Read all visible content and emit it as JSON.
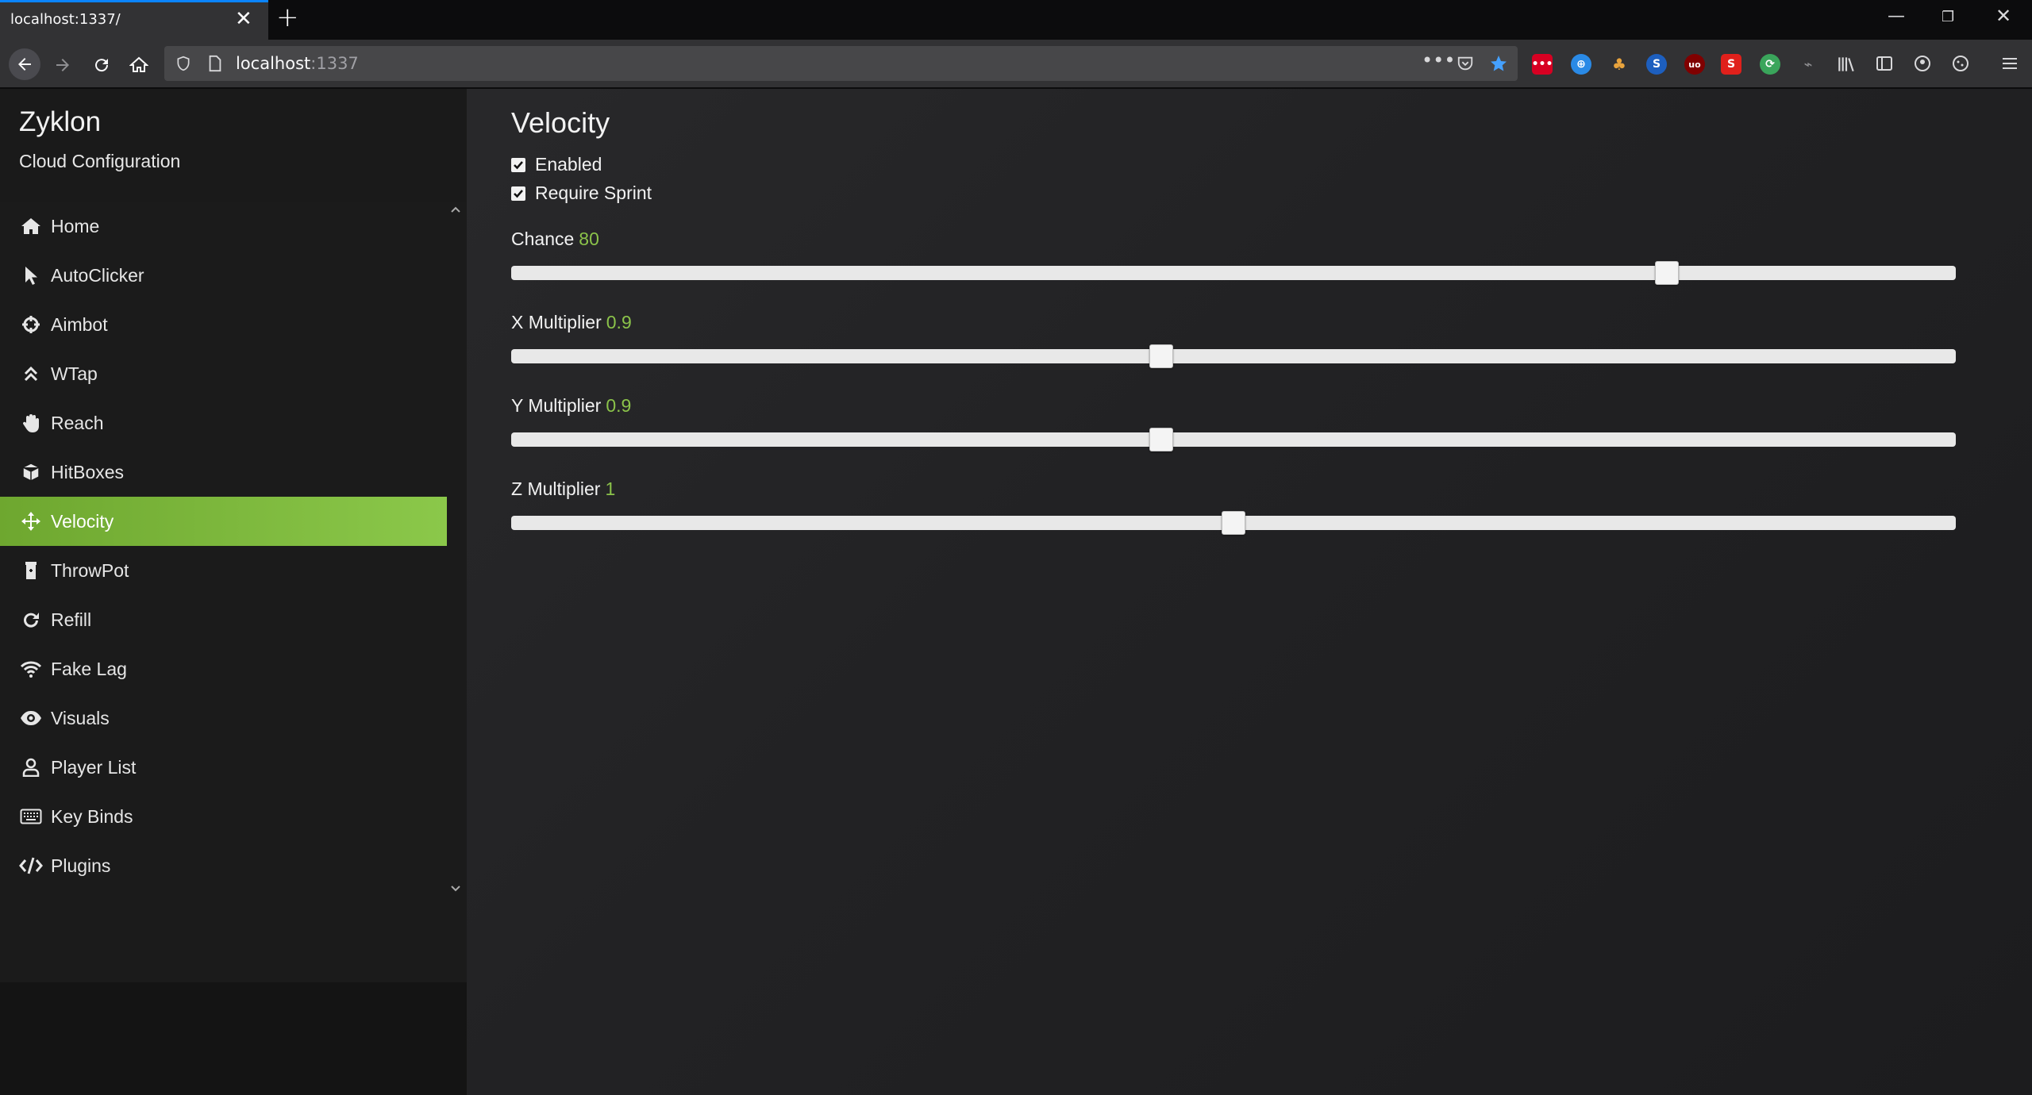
{
  "browser": {
    "tab_title": "localhost:1337/",
    "url_host": "localhost",
    "url_port": ":1337"
  },
  "sidebar": {
    "title": "Zyklon",
    "subtitle": "Cloud Configuration",
    "active_item": "Velocity",
    "accent_color": "#8bc34a",
    "items": [
      {
        "label": "Home",
        "icon": "home-icon"
      },
      {
        "label": "AutoClicker",
        "icon": "pointer-icon"
      },
      {
        "label": "Aimbot",
        "icon": "crosshair-icon"
      },
      {
        "label": "WTap",
        "icon": "double-chevron-up-icon"
      },
      {
        "label": "Reach",
        "icon": "hand-icon"
      },
      {
        "label": "HitBoxes",
        "icon": "cube-icon"
      },
      {
        "label": "Velocity",
        "icon": "arrows-move-icon"
      },
      {
        "label": "ThrowPot",
        "icon": "bottle-icon"
      },
      {
        "label": "Refill",
        "icon": "redo-icon"
      },
      {
        "label": "Fake Lag",
        "icon": "wifi-icon"
      },
      {
        "label": "Visuals",
        "icon": "eye-icon"
      },
      {
        "label": "Player List",
        "icon": "user-icon"
      },
      {
        "label": "Key Binds",
        "icon": "keyboard-icon"
      },
      {
        "label": "Plugins",
        "icon": "code-icon"
      }
    ]
  },
  "main": {
    "title": "Velocity",
    "checkboxes": [
      {
        "label": "Enabled",
        "checked": true
      },
      {
        "label": "Require Sprint",
        "checked": true
      }
    ],
    "sliders": [
      {
        "label": "Chance",
        "value": "80",
        "fraction": 0.8
      },
      {
        "label": "X Multiplier",
        "value": "0.9",
        "fraction": 0.45
      },
      {
        "label": "Y Multiplier",
        "value": "0.9",
        "fraction": 0.45
      },
      {
        "label": "Z Multiplier",
        "value": "1",
        "fraction": 0.5
      }
    ]
  }
}
